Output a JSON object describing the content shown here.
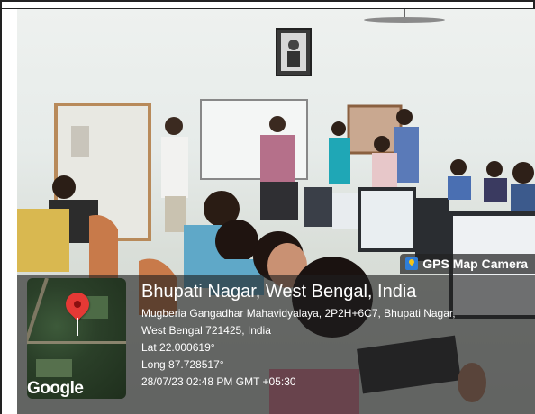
{
  "gps_tag": {
    "label": "GPS Map Camera"
  },
  "map": {
    "brand": "Google"
  },
  "location": {
    "title": "Bhupati Nagar, West Bengal, India",
    "address_line1": "Mugberia Gangadhar Mahavidyalaya, 2P2H+6C7, Bhupati Nagar,",
    "address_line2": "West Bengal 721425, India",
    "lat": "Lat 22.000619°",
    "long": "Long 87.728517°",
    "timestamp": "28/07/23 02:48 PM GMT +05:30"
  },
  "colors": {
    "pin": "#e53935",
    "overlay": "#1e1e1e",
    "logo": "#2f7ed8"
  }
}
